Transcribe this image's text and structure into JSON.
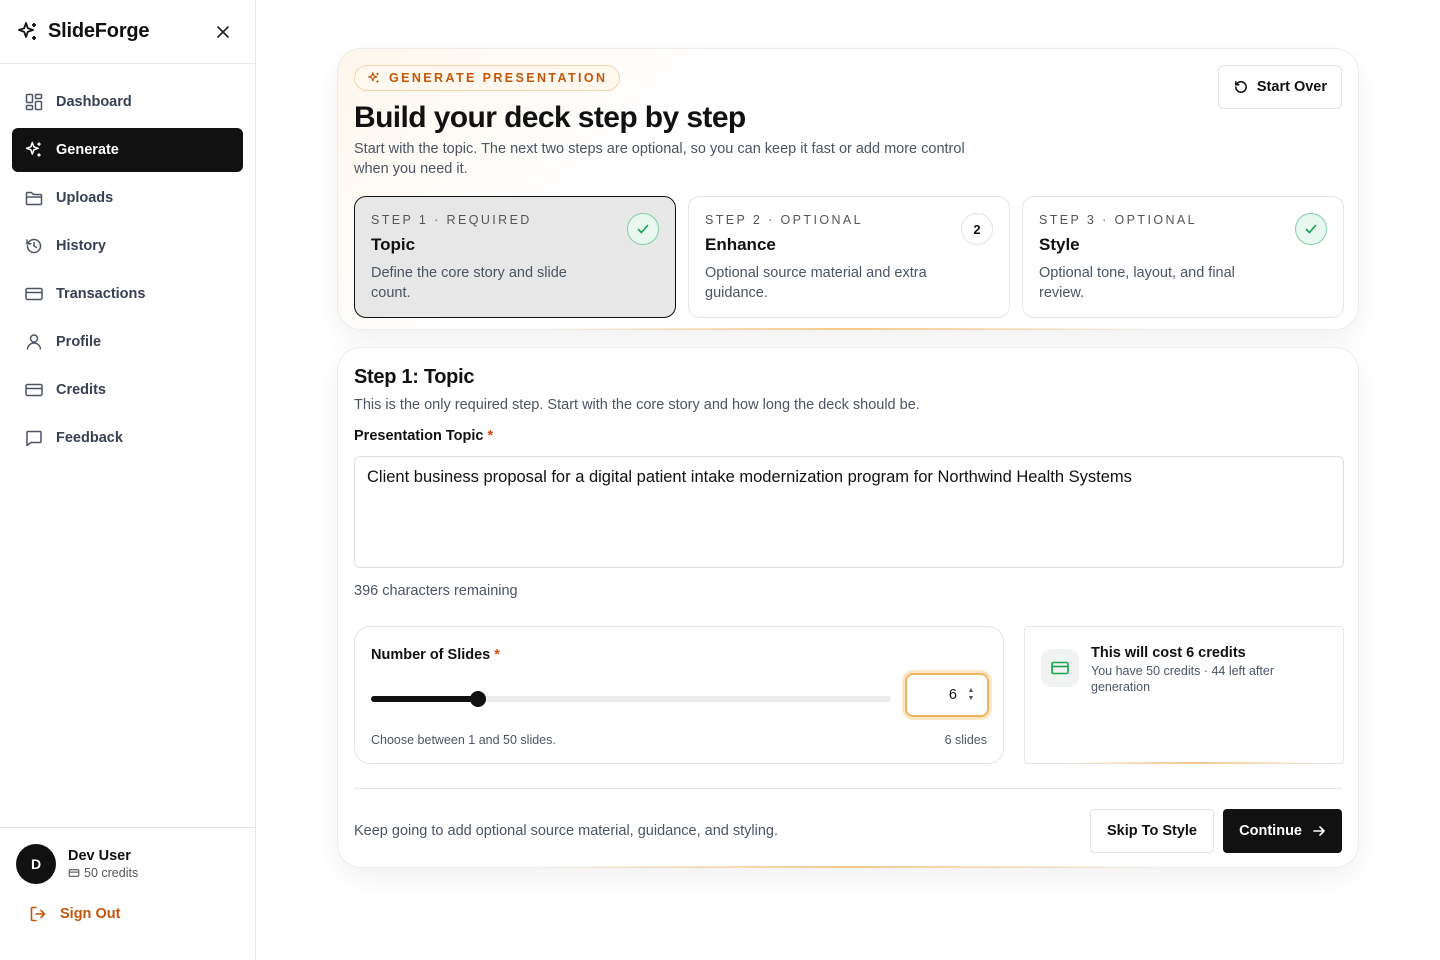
{
  "app": {
    "name": "SlideForge"
  },
  "sidebar": {
    "items": [
      {
        "label": "Dashboard",
        "icon": "dashboard-icon",
        "active": false
      },
      {
        "label": "Generate",
        "icon": "sparkles-icon",
        "active": true
      },
      {
        "label": "Uploads",
        "icon": "folder-icon",
        "active": false
      },
      {
        "label": "History",
        "icon": "history-icon",
        "active": false
      },
      {
        "label": "Transactions",
        "icon": "credit-card-icon",
        "active": false
      },
      {
        "label": "Profile",
        "icon": "user-icon",
        "active": false
      },
      {
        "label": "Credits",
        "icon": "credit-card-icon",
        "active": false
      },
      {
        "label": "Feedback",
        "icon": "message-icon",
        "active": false
      }
    ],
    "user": {
      "initial": "D",
      "name": "Dev User",
      "credits": "50 credits"
    },
    "signout_label": "Sign Out"
  },
  "hero": {
    "badge": "GENERATE PRESENTATION",
    "start_over": "Start Over",
    "title": "Build your deck step by step",
    "subtitle": "Start with the topic. The next two steps are optional, so you can keep it fast or add more control when you need it.",
    "steps": [
      {
        "kicker": "STEP 1 · REQUIRED",
        "title": "Topic",
        "desc": "Define the core story and slide count.",
        "marker": "check",
        "active": true
      },
      {
        "kicker": "STEP 2 · OPTIONAL",
        "title": "Enhance",
        "desc": "Optional source material and extra guidance.",
        "marker": "2",
        "active": false
      },
      {
        "kicker": "STEP 3 · OPTIONAL",
        "title": "Style",
        "desc": "Optional tone, layout, and final review.",
        "marker": "check",
        "active": false
      }
    ]
  },
  "step1": {
    "title": "Step 1: Topic",
    "subtitle": "This is the only required step. Start with the core story and how long the deck should be.",
    "topic_label": "Presentation Topic",
    "required_mark": "*",
    "topic_value": "Client business proposal for a digital patient intake modernization program for Northwind Health Systems",
    "remaining": "396 characters remaining",
    "slides": {
      "label": "Number of Slides",
      "value": "6",
      "min": 1,
      "max": 50,
      "help": "Choose between 1 and 50 slides.",
      "count_label": "6 slides"
    },
    "cost": {
      "prefix": "This will cost ",
      "amount": "6 credits",
      "sub": "You have 50 credits · 44 left after generation"
    },
    "footer_text": "Keep going to add optional source material, guidance, and styling.",
    "skip_label": "Skip To Style",
    "continue_label": "Continue"
  },
  "colors": {
    "accent": "#c2570c",
    "primary": "#111111",
    "success": "#16a34a"
  }
}
